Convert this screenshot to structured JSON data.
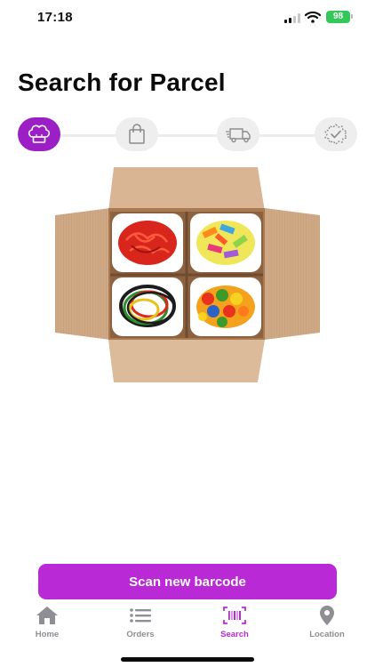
{
  "status_bar": {
    "time": "17:18",
    "battery": "98"
  },
  "page": {
    "title": "Search for Parcel"
  },
  "steps": [
    {
      "icon": "chef-hat-icon",
      "state": "active"
    },
    {
      "icon": "shopping-bag-icon",
      "state": "inactive"
    },
    {
      "icon": "delivery-truck-icon",
      "state": "inactive"
    },
    {
      "icon": "badge-check-icon",
      "state": "inactive"
    }
  ],
  "illustration": {
    "icon": "open-parcel-box-with-candy"
  },
  "actions": {
    "scan_label": "Scan new barcode"
  },
  "tabs": [
    {
      "label": "Home",
      "icon": "home-icon",
      "active": false
    },
    {
      "label": "Orders",
      "icon": "list-icon",
      "active": false
    },
    {
      "label": "Search",
      "icon": "barcode-icon",
      "active": true
    },
    {
      "label": "Location",
      "icon": "location-pin-icon",
      "active": false
    }
  ],
  "colors": {
    "accent": "#b92ad6",
    "step_active": "#9b1fc4",
    "inactive": "#8e8e93",
    "battery": "#34c759"
  }
}
